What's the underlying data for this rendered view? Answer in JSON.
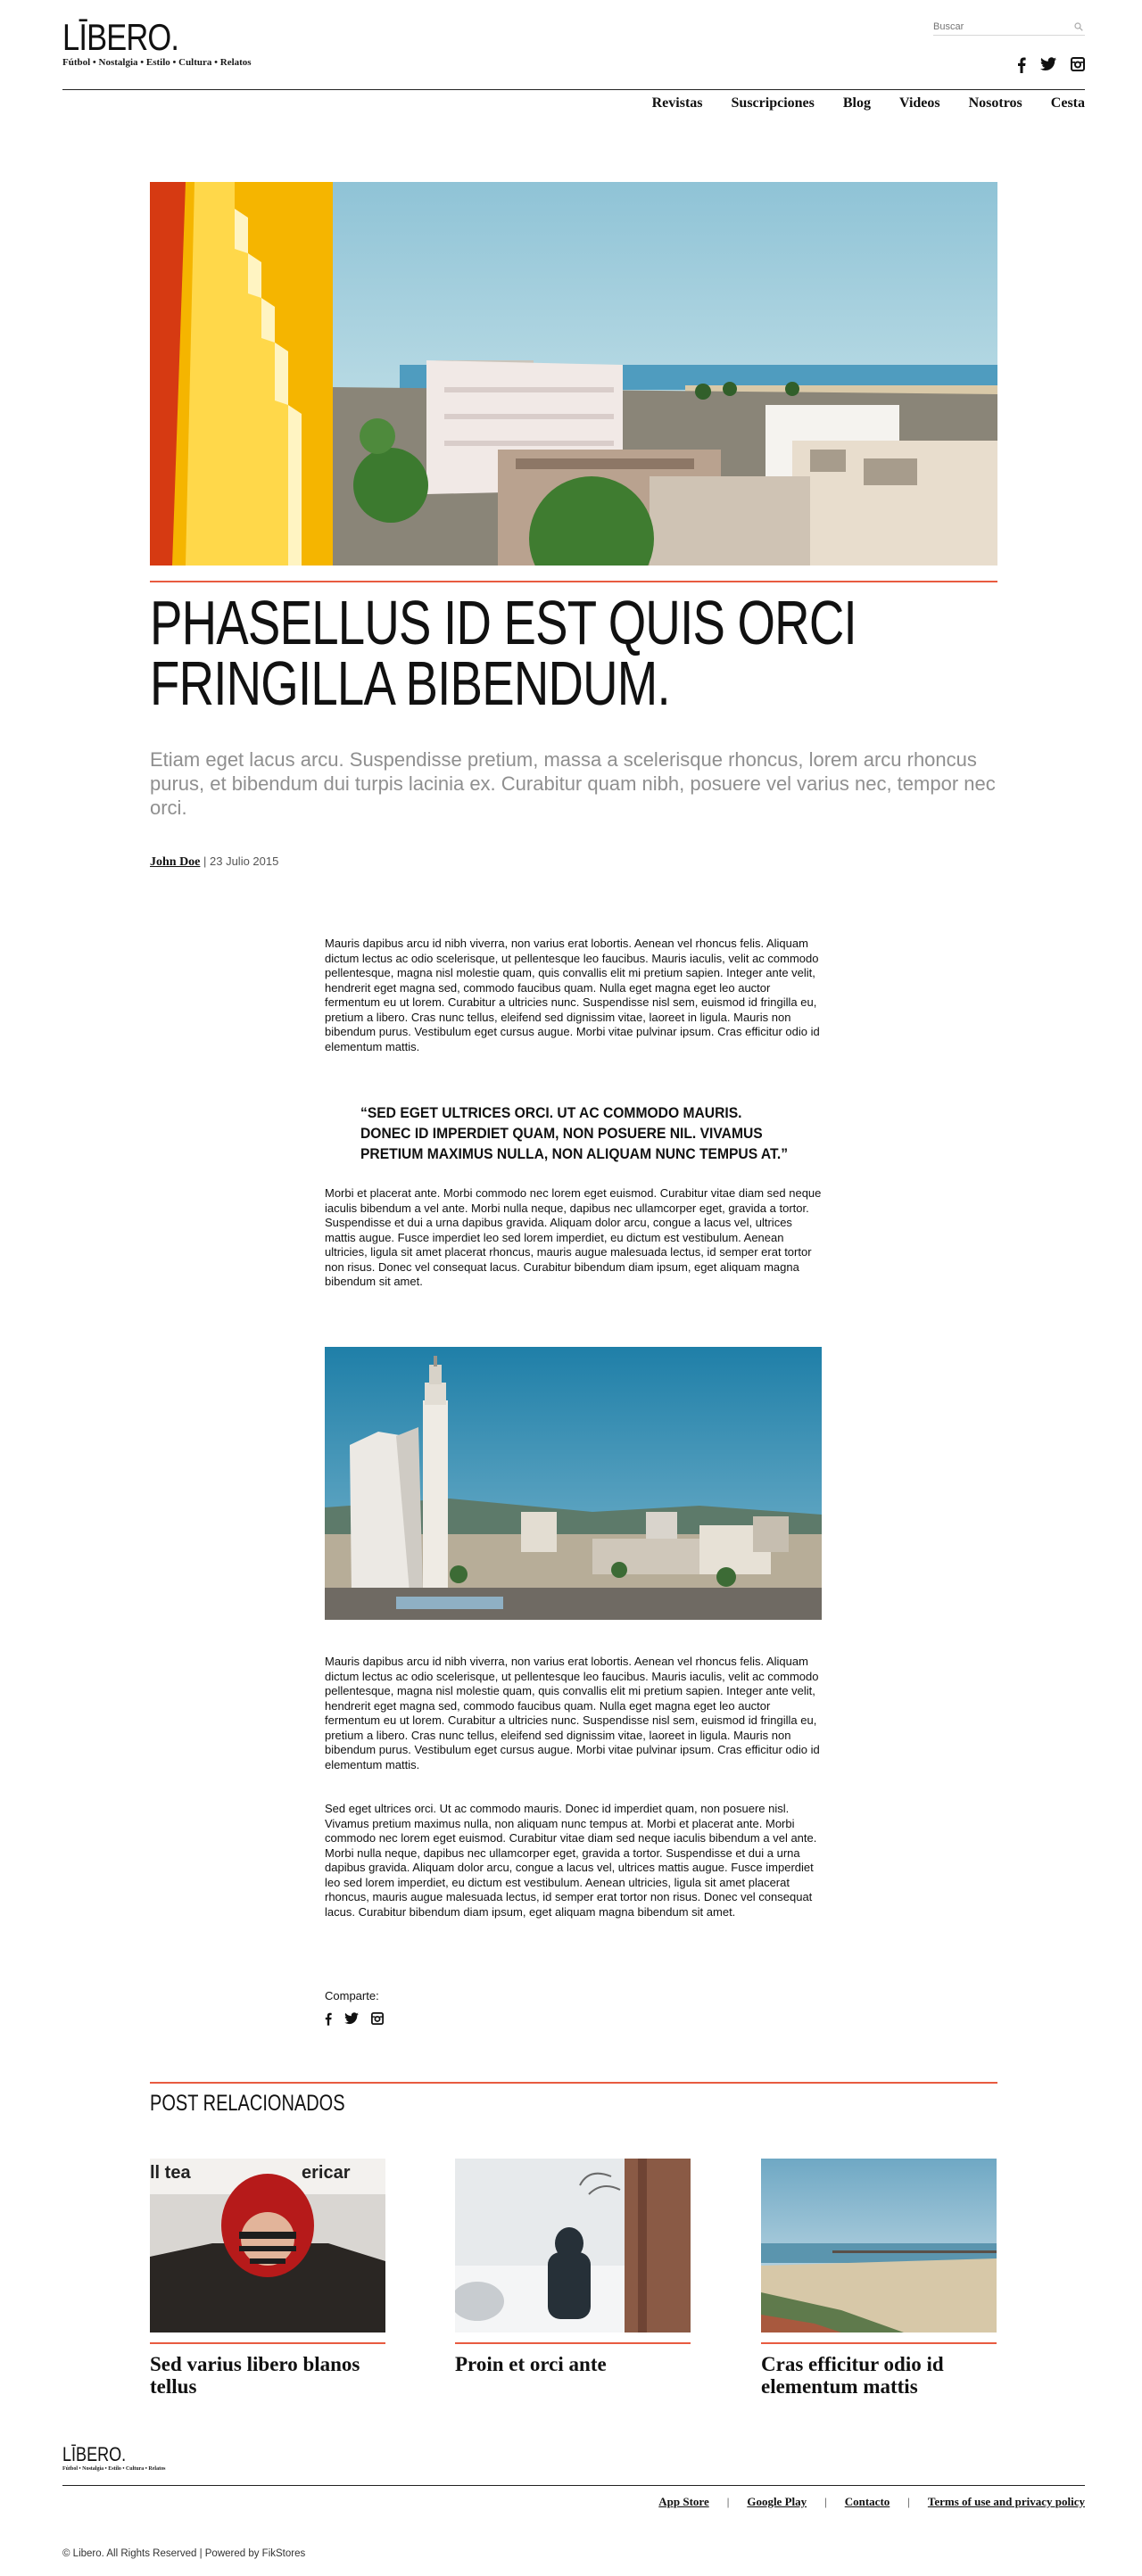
{
  "brand": {
    "name": "LĪBERO.",
    "tagline": "Fútbol • Nostalgia • Estilo • Cultura • Relatos",
    "accent_color": "#e85b40"
  },
  "search": {
    "placeholder": "Buscar"
  },
  "social": [
    "facebook-icon",
    "twitter-icon",
    "instagram-icon"
  ],
  "nav": {
    "items": [
      "Revistas",
      "Suscripciones",
      "Blog",
      "Videos",
      "Nosotros",
      "Cesta"
    ]
  },
  "article": {
    "headline_line1": "PHASELLUS ID EST QUIS ORCI",
    "headline_line2": "FRINGILLA BIBENDUM.",
    "dek": "Etiam eget lacus arcu. Suspendisse pretium, massa a scelerisque rhoncus, lorem arcu rhoncus purus, et bibendum dui turpis lacinia ex. Curabitur quam nibh, posuere vel varius nec, tempor nec orci.",
    "author": "John Doe",
    "date": " | 23 Julio 2015",
    "paragraph1": "Mauris dapibus arcu id nibh viverra, non varius erat lobortis. Aenean vel rhoncus felis. Aliquam dictum lectus ac odio scelerisque, ut pellentesque leo faucibus. Mauris iaculis, velit ac commodo pellentesque, magna nisl molestie quam, quis convallis elit mi pretium sapien. Integer ante velit, hendrerit eget magna sed, commodo faucibus quam. Nulla eget magna eget leo auctor fermentum eu ut lorem. Curabitur a ultricies nunc. Suspendisse nisl sem, euismod id fringilla eu, pretium a libero. Cras nunc tellus, eleifend sed dignissim vitae, laoreet in ligula. Mauris non bibendum purus. Vestibulum eget cursus augue. Morbi vitae pulvinar ipsum. Cras efficitur odio id elementum mattis.",
    "quote": "“SED EGET ULTRICES ORCI. UT AC COMMODO MAURIS. DONEC ID IMPERDIET QUAM, NON POSUERE NIL. VIVAMUS PRETIUM MAXIMUS NULLA, NON ALIQUAM NUNC TEMPUS AT.”",
    "paragraph2": "Morbi et placerat ante. Morbi commodo nec lorem eget euismod. Curabitur vitae diam sed neque iaculis bibendum a vel ante. Morbi nulla neque, dapibus nec ullamcorper eget, gravida a tortor. Suspendisse et dui a urna dapibus gravida. Aliquam dolor arcu, congue a lacus vel, ultrices mattis augue. Fusce imperdiet leo sed lorem imperdiet, eu dictum est vestibulum. Aenean ultricies, ligula sit amet placerat rhoncus, mauris augue malesuada lectus, id semper erat tortor non risus. Donec vel consequat lacus. Curabitur bibendum diam ipsum, eget aliquam magna bibendum sit amet.",
    "paragraph3": "Mauris dapibus arcu id nibh viverra, non varius erat lobortis. Aenean vel rhoncus felis. Aliquam dictum lectus ac odio scelerisque, ut pellentesque leo faucibus. Mauris iaculis, velit ac commodo pellentesque, magna nisl molestie quam, quis convallis elit mi pretium sapien. Integer ante velit, hendrerit eget magna sed, commodo faucibus quam. Nulla eget magna eget leo auctor fermentum eu ut lorem. Curabitur a ultricies nunc. Suspendisse nisl sem, euismod id fringilla eu, pretium a libero. Cras nunc tellus, eleifend sed dignissim vitae, laoreet in ligula. Mauris non bibendum purus. Vestibulum eget cursus augue. Morbi vitae pulvinar ipsum. Cras efficitur odio id elementum mattis.",
    "paragraph4": "Sed eget ultrices orci. Ut ac commodo mauris. Donec id imperdiet quam, non posuere nisl. Vivamus pretium maximus nulla, non aliquam nunc tempus at. Morbi et placerat ante. Morbi commodo nec lorem eget euismod. Curabitur vitae diam sed neque iaculis bibendum a vel ante. Morbi nulla neque, dapibus nec ullamcorper eget, gravida a tortor. Suspendisse et dui a urna dapibus gravida. Aliquam dolor arcu, congue a lacus vel, ultrices mattis augue. Fusce imperdiet leo sed lorem imperdiet, eu dictum est vestibulum. Aenean ultricies, ligula sit amet placerat rhoncus, mauris augue malesuada lectus, id semper erat tortor non risus. Donec vel consequat lacus. Curabitur bibendum diam ipsum, eget aliquam magna bibendum sit amet.",
    "share_label": "Comparte:"
  },
  "related": {
    "title": "POST RELACIONADOS",
    "posts": [
      {
        "title": "Sed varius libero blanos tellus"
      },
      {
        "title": "Proin et orci ante"
      },
      {
        "title": "Cras efficitur odio id elementum mattis"
      }
    ]
  },
  "footer": {
    "links": [
      "App Store",
      "Google Play",
      "Contacto",
      "Terms of use and privacy policy"
    ],
    "separator": "|",
    "copyright": "© Libero. All Rights Reserved | Powered by FikStores"
  }
}
